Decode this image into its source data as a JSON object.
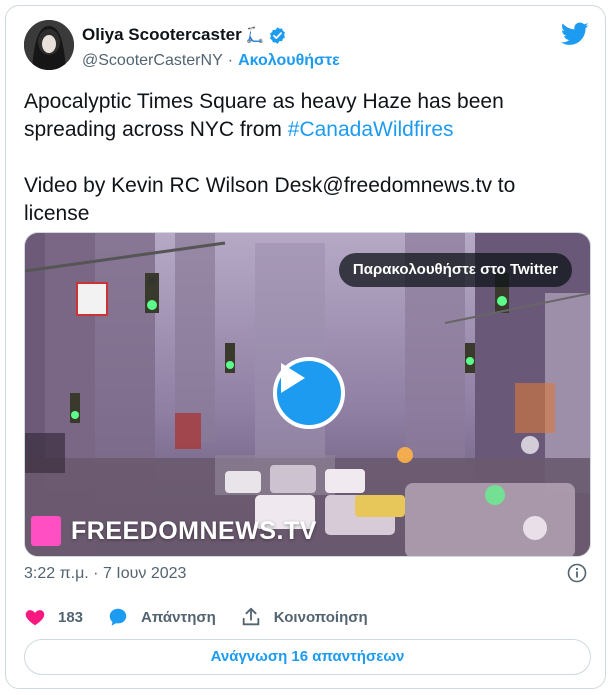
{
  "author": {
    "name": "Oliya Scootercaster",
    "emoji": "🛴",
    "handle": "@ScooterCasterNY",
    "separator": "·",
    "follow_label": "Ακολουθήστε",
    "verified": true
  },
  "tweet": {
    "line1_text": "Apocalyptic Times Square as heavy Haze has been spreading across NYC from ",
    "hashtag": "#CanadaWildfires",
    "line2_text": "Video by Kevin RC Wilson Desk@freedomnews.tv to license"
  },
  "media": {
    "watch_label": "Παρακολουθήστε στο Twitter",
    "watermark": "FREEDOMNEWS.TV",
    "watermark_color": "#ff4fc3"
  },
  "meta": {
    "timestamp": "3:22 π.μ. · 7 Ιουν 2023"
  },
  "actions": {
    "likes": "183",
    "reply_label": "Απάντηση",
    "share_label": "Κοινοποίηση"
  },
  "footer": {
    "read_replies_label": "Ανάγνωση 16 απαντήσεων"
  },
  "colors": {
    "accent": "#1d9bf0",
    "like": "#f91880",
    "text": "#0f1419",
    "secondary": "#536471"
  }
}
